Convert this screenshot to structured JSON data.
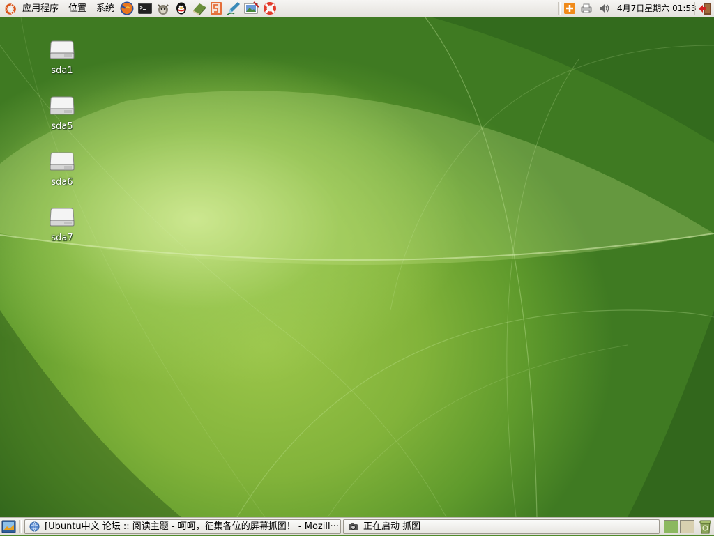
{
  "top_panel": {
    "menus": {
      "applications": "应用程序",
      "places": "位置",
      "system": "系统"
    },
    "launchers": [
      "firefox-icon",
      "terminal-icon",
      "gimp-icon",
      "qq-icon",
      "dictionary-icon",
      "impress-icon",
      "editor-icon",
      "screenshot-icon",
      "help-icon"
    ],
    "tray": [
      "update-notifier-icon",
      "printer-icon",
      "volume-icon"
    ],
    "clock": "4月7日星期六 01:53",
    "logout_icon": "logout-icon"
  },
  "desktop": {
    "icons": [
      {
        "label": "sda1",
        "icon": "drive-icon"
      },
      {
        "label": "sda5",
        "icon": "drive-icon"
      },
      {
        "label": "sda6",
        "icon": "drive-icon"
      },
      {
        "label": "sda7",
        "icon": "drive-icon"
      }
    ],
    "colors": {
      "wallpaper_base": "#4b8a2a",
      "wallpaper_glow": "#c9e47d"
    }
  },
  "bottom_panel": {
    "show_desktop_icon": "show-desktop-icon",
    "tasks": [
      {
        "label": "[Ubuntu中文 论坛 :: 阅读主题 - 呵呵，征集各位的屏幕抓图！ - Mozill···",
        "icon": "globe-icon"
      },
      {
        "label": "正在启动 抓图",
        "icon": "camera-icon"
      }
    ],
    "workspaces": {
      "active_color": "#8cb860",
      "inactive_color": "#d8d0b0"
    },
    "trash_icon": "trash-icon"
  }
}
